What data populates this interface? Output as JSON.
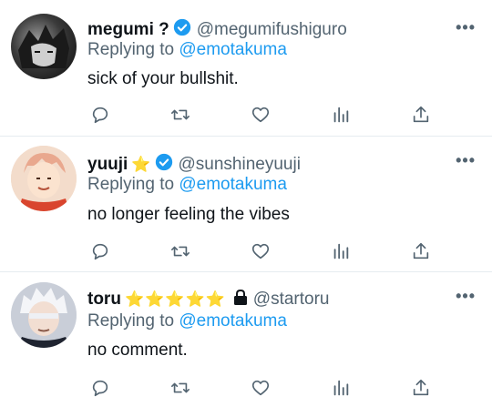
{
  "tweets": [
    {
      "name": "megumi ?",
      "badges": "",
      "handle": "@megumifushiguro",
      "replying_prefix": "Replying to ",
      "replying_to": "@emotakuma",
      "text": "sick of your bullshit.",
      "more": "•••"
    },
    {
      "name": "yuuji",
      "badges": "⭐",
      "handle": "@sunshineyuuji",
      "replying_prefix": "Replying to ",
      "replying_to": "@emotakuma",
      "text": "no longer feeling the vibes",
      "more": "•••"
    },
    {
      "name": "toru",
      "badges": "⭐⭐⭐⭐⭐",
      "handle": "@startoru",
      "replying_prefix": "Replying to ",
      "replying_to": "@emotakuma",
      "text": "no comment.",
      "more": "•••"
    }
  ],
  "colors": {
    "accent": "#1d9bf0",
    "muted": "#536471",
    "text": "#0f1419",
    "divider": "#e6ecf0"
  },
  "icons": [
    "reply-icon",
    "retweet-icon",
    "like-icon",
    "analytics-icon",
    "share-icon",
    "verified-icon",
    "lock-icon",
    "more-icon"
  ]
}
